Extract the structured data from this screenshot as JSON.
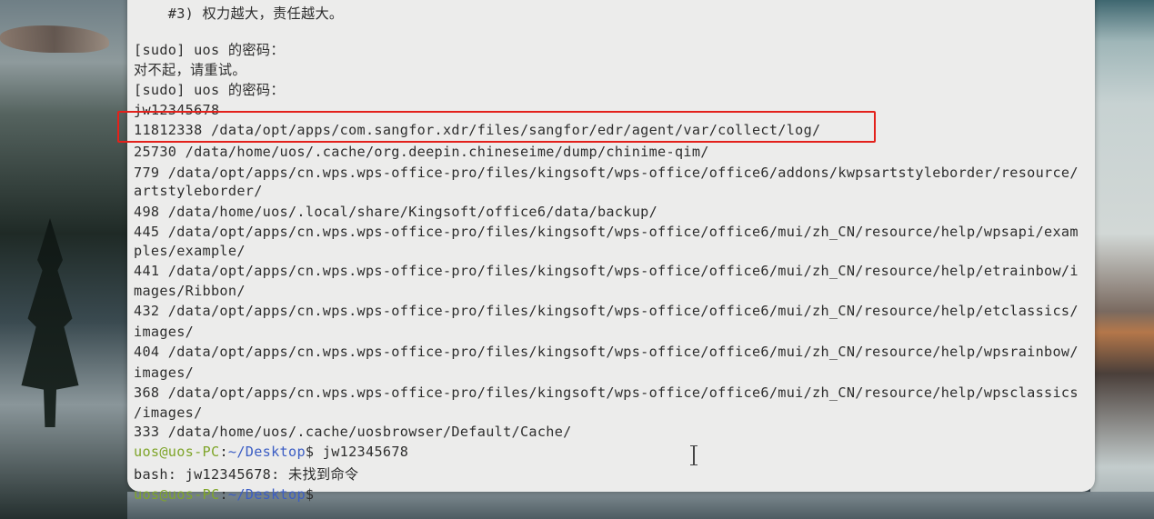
{
  "terminal": {
    "lines": [
      {
        "text": "    #3) 权力越大，责任越大。"
      },
      {
        "text": ""
      },
      {
        "text": "[sudo] uos 的密码："
      },
      {
        "text": "对不起，请重试。"
      },
      {
        "text": "[sudo] uos 的密码："
      },
      {
        "text": "jw12345678"
      },
      {
        "text": "11812338 /data/opt/apps/com.sangfor.xdr/files/sangfor/edr/agent/var/collect/log/"
      },
      {
        "text": "25730 /data/home/uos/.cache/org.deepin.chineseime/dump/chinime-qim/"
      },
      {
        "text": "779 /data/opt/apps/cn.wps.wps-office-pro/files/kingsoft/wps-office/office6/addons/kwpsartstyleborder/resource/"
      },
      {
        "text": "artstyleborder/"
      },
      {
        "text": "498 /data/home/uos/.local/share/Kingsoft/office6/data/backup/"
      },
      {
        "text": "445 /data/opt/apps/cn.wps.wps-office-pro/files/kingsoft/wps-office/office6/mui/zh_CN/resource/help/wpsapi/exam"
      },
      {
        "text": "ples/example/"
      },
      {
        "text": "441 /data/opt/apps/cn.wps.wps-office-pro/files/kingsoft/wps-office/office6/mui/zh_CN/resource/help/etrainbow/i"
      },
      {
        "text": "mages/Ribbon/"
      },
      {
        "text": "432 /data/opt/apps/cn.wps.wps-office-pro/files/kingsoft/wps-office/office6/mui/zh_CN/resource/help/etclassics/"
      },
      {
        "text": "images/"
      },
      {
        "text": "404 /data/opt/apps/cn.wps.wps-office-pro/files/kingsoft/wps-office/office6/mui/zh_CN/resource/help/wpsrainbow/"
      },
      {
        "text": "images/"
      },
      {
        "text": "368 /data/opt/apps/cn.wps.wps-office-pro/files/kingsoft/wps-office/office6/mui/zh_CN/resource/help/wpsclassics"
      },
      {
        "text": "/images/"
      },
      {
        "text": "333 /data/home/uos/.cache/uosbrowser/Default/Cache/"
      }
    ],
    "prompt1": {
      "user": "uos@uos-PC",
      "sep": ":",
      "path": "~/Desktop",
      "dollar": "$",
      "command": " jw12345678"
    },
    "error_line": "bash: jw12345678: 未找到命令",
    "prompt2": {
      "user": "uos@uos-PC",
      "sep": ":",
      "path": "~/Desktop",
      "dollar": "$"
    }
  },
  "colors": {
    "prompt_user": "#7fa52a",
    "prompt_path": "#3c5ec4",
    "highlight": "#e3211b",
    "terminal_bg": "#ececeb"
  },
  "icons": {
    "cursor": "text-cursor-icon"
  }
}
